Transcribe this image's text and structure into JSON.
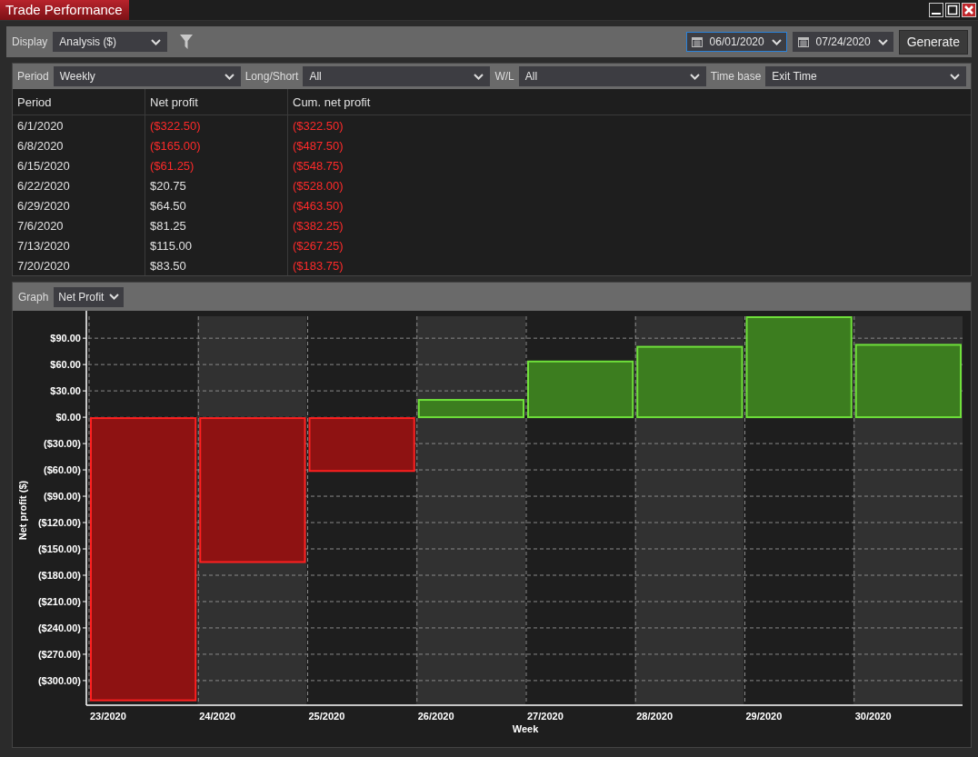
{
  "window": {
    "title": "Trade Performance"
  },
  "toolbar": {
    "display_label": "Display",
    "display_value": "Analysis ($)",
    "from_date": "06/01/2020",
    "from_focused": true,
    "to_date": "07/24/2020",
    "generate": "Generate"
  },
  "filters": [
    {
      "label": "Period",
      "value": "Weekly"
    },
    {
      "label": "Long/Short",
      "value": "All"
    },
    {
      "label": "W/L",
      "value": "All"
    },
    {
      "label": "Time base",
      "value": "Exit Time"
    }
  ],
  "table": {
    "columns": [
      "Period",
      "Net profit",
      "Cum. net profit"
    ],
    "rows": [
      {
        "cells": [
          "6/1/2020",
          "($322.50)",
          "($322.50)"
        ],
        "negative": [
          false,
          true,
          true
        ]
      },
      {
        "cells": [
          "6/8/2020",
          "($165.00)",
          "($487.50)"
        ],
        "negative": [
          false,
          true,
          true
        ]
      },
      {
        "cells": [
          "6/15/2020",
          "($61.25)",
          "($548.75)"
        ],
        "negative": [
          false,
          true,
          true
        ]
      },
      {
        "cells": [
          "6/22/2020",
          "$20.75",
          "($528.00)"
        ],
        "negative": [
          false,
          false,
          true
        ]
      },
      {
        "cells": [
          "6/29/2020",
          "$64.50",
          "($463.50)"
        ],
        "negative": [
          false,
          false,
          true
        ]
      },
      {
        "cells": [
          "7/6/2020",
          "$81.25",
          "($382.25)"
        ],
        "negative": [
          false,
          false,
          true
        ]
      },
      {
        "cells": [
          "7/13/2020",
          "$115.00",
          "($267.25)"
        ],
        "negative": [
          false,
          false,
          true
        ]
      },
      {
        "cells": [
          "7/20/2020",
          "$83.50",
          "($183.75)"
        ],
        "negative": [
          false,
          false,
          true
        ]
      }
    ]
  },
  "graph": {
    "label": "Graph",
    "value": "Net Profit",
    "chart_data": {
      "type": "bar",
      "xlabel": "Week",
      "ylabel": "Net profit ($)",
      "categories": [
        "23/2020",
        "24/2020",
        "25/2020",
        "26/2020",
        "27/2020",
        "28/2020",
        "29/2020",
        "30/2020"
      ],
      "grid": true,
      "series": [
        {
          "color": "#8e1212",
          "values": [
            -322.5,
            -165,
            -61.25,
            null,
            null,
            null,
            null,
            null
          ]
        },
        {
          "color": "#3c7d1f",
          "values": [
            null,
            null,
            null,
            20.75,
            64.5,
            81.25,
            115,
            83.5
          ]
        }
      ],
      "ylim": [
        -327,
        115
      ],
      "yticks": [
        {
          "value": 90,
          "label": "$90.00"
        },
        {
          "value": 60,
          "label": "$60.00"
        },
        {
          "value": 30,
          "label": "$30.00"
        },
        {
          "value": 0,
          "label": "$0.00"
        },
        {
          "value": -30,
          "label": "($30.00)"
        },
        {
          "value": -60,
          "label": "($60.00)"
        },
        {
          "value": -90,
          "label": "($90.00)"
        },
        {
          "value": -120,
          "label": "($120.00)"
        },
        {
          "value": -150,
          "label": "($150.00)"
        },
        {
          "value": -180,
          "label": "($180.00)"
        },
        {
          "value": -210,
          "label": "($210.00)"
        },
        {
          "value": -240,
          "label": "($240.00)"
        },
        {
          "value": -270,
          "label": "($270.00)"
        },
        {
          "value": -300,
          "label": "($300.00)"
        }
      ]
    }
  }
}
